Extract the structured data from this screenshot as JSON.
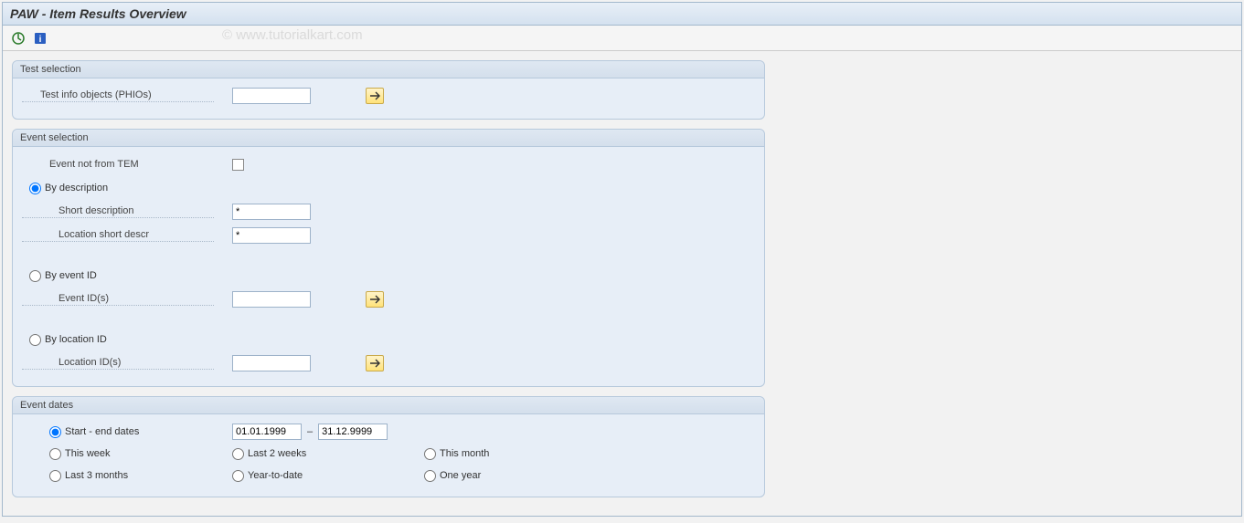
{
  "title": "PAW - Item Results Overview",
  "watermark": "© www.tutorialkart.com",
  "toolbar": {
    "execute_icon": "execute",
    "info_icon": "info"
  },
  "groups": {
    "test_selection": {
      "title": "Test selection",
      "field_label": "Test info objects (PHIOs)",
      "field_value": ""
    },
    "event_selection": {
      "title": "Event selection",
      "event_not_tem_label": "Event not from TEM",
      "event_not_tem_checked": false,
      "by_description": {
        "label": "By description",
        "selected": true,
        "short_desc_label": "Short description",
        "short_desc_value": "*",
        "location_short_label": "Location short descr",
        "location_short_value": "*"
      },
      "by_event_id": {
        "label": "By event ID",
        "selected": false,
        "event_ids_label": "Event ID(s)",
        "event_ids_value": ""
      },
      "by_location_id": {
        "label": "By location ID",
        "selected": false,
        "location_ids_label": "Location ID(s)",
        "location_ids_value": ""
      }
    },
    "event_dates": {
      "title": "Event dates",
      "start_end": {
        "label": "Start - end dates",
        "selected": true,
        "from": "01.01.1999",
        "sep": "–",
        "to": "31.12.9999"
      },
      "this_week": "This week",
      "last_2_weeks": "Last 2 weeks",
      "this_month": "This month",
      "last_3_months": "Last 3 months",
      "year_to_date": "Year-to-date",
      "one_year": "One year"
    }
  }
}
